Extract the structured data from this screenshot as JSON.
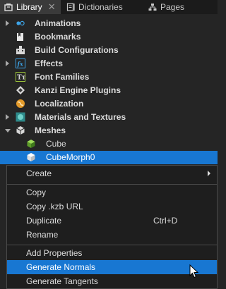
{
  "tabs": [
    {
      "label": "Library",
      "icon": "library-icon",
      "active": true,
      "closable": true
    },
    {
      "label": "Dictionaries",
      "icon": "dictionaries-icon",
      "active": false
    },
    {
      "label": "Pages",
      "icon": "pages-icon",
      "active": false
    }
  ],
  "tree": {
    "items": [
      {
        "label": "Animations",
        "icon": "animations-icon",
        "expander": "collapsed"
      },
      {
        "label": "Bookmarks",
        "icon": "bookmarks-icon",
        "expander": "none"
      },
      {
        "label": "Build Configurations",
        "icon": "build-configurations-icon",
        "expander": "none"
      },
      {
        "label": "Effects",
        "icon": "effects-icon",
        "expander": "collapsed"
      },
      {
        "label": "Font Families",
        "icon": "font-families-icon",
        "expander": "none"
      },
      {
        "label": "Kanzi Engine Plugins",
        "icon": "plugins-icon",
        "expander": "none"
      },
      {
        "label": "Localization",
        "icon": "localization-icon",
        "expander": "none"
      },
      {
        "label": "Materials and Textures",
        "icon": "materials-icon",
        "expander": "collapsed"
      },
      {
        "label": "Meshes",
        "icon": "meshes-icon",
        "expander": "expanded"
      },
      {
        "label": "Cube",
        "icon": "mesh-cube-icon",
        "expander": "none",
        "child": true
      },
      {
        "label": "CubeMorph0",
        "icon": "mesh-cube-icon",
        "expander": "none",
        "child": true,
        "selected": true
      }
    ]
  },
  "context_menu": {
    "items": [
      {
        "label": "Create",
        "submenu": true
      },
      {
        "separator": true
      },
      {
        "label": "Copy"
      },
      {
        "label": "Copy .kzb URL"
      },
      {
        "label": "Duplicate",
        "shortcut": "Ctrl+D"
      },
      {
        "label": "Rename"
      },
      {
        "separator": true
      },
      {
        "label": "Add Properties"
      },
      {
        "label": "Generate Normals",
        "hovered": true
      },
      {
        "label": "Generate Tangents"
      }
    ]
  },
  "colors": {
    "selection": "#1877d2",
    "background": "#252525",
    "menu_background": "#1e1e1e"
  }
}
